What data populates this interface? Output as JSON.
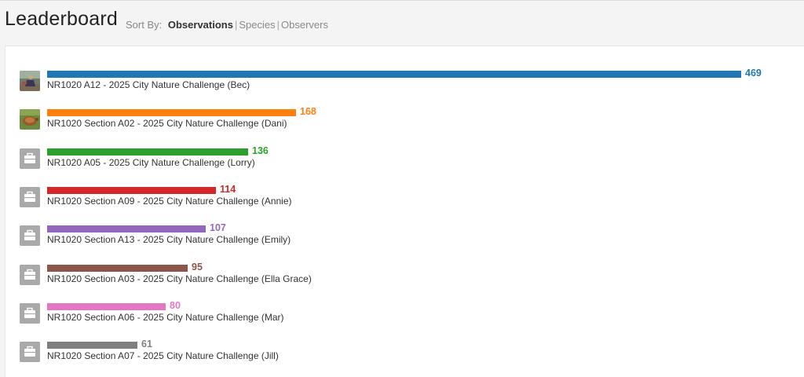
{
  "header": {
    "title": "Leaderboard",
    "sort_label": "Sort By:",
    "sort_options": [
      "Observations",
      "Species",
      "Observers"
    ],
    "active_sort": "Observations"
  },
  "chart_data": {
    "type": "bar",
    "max_value": 469,
    "categories": [
      "NR1020 A12 - 2025 City Nature Challenge (Bec)",
      "NR1020 Section A02 - 2025 City Nature Challenge (Dani)",
      "NR1020 A05 - 2025 City Nature Challenge (Lorry)",
      "NR1020 Section A09 - 2025 City Nature Challenge (Annie)",
      "NR1020 Section A13 - 2025 City Nature Challenge (Emily)",
      "NR1020 Section A03 - 2025 City Nature Challenge (Ella Grace)",
      "NR1020 Section A06 - 2025 City Nature Challenge (Mar)",
      "NR1020 Section A07 - 2025 City Nature Challenge (Jill)"
    ],
    "values": [
      469,
      168,
      136,
      114,
      107,
      95,
      80,
      61
    ],
    "colors": [
      "#1f77b4",
      "#ff7f0e",
      "#2ca02c",
      "#d62728",
      "#9467bd",
      "#8c564b",
      "#e377c2",
      "#7f7f7f"
    ],
    "avatars": [
      "photo-person-icon",
      "photo-turtle-icon",
      "briefcase-icon",
      "briefcase-icon",
      "briefcase-icon",
      "briefcase-icon",
      "briefcase-icon",
      "briefcase-icon"
    ]
  }
}
